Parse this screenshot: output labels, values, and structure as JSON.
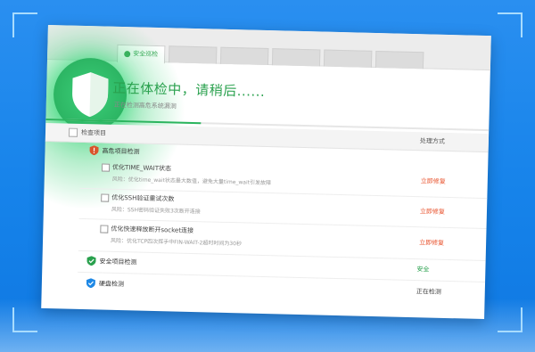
{
  "colors": {
    "accent_green": "#2aa14e",
    "fix_red": "#e8512b",
    "background_blue": "#1683ea"
  },
  "tabs": [
    {
      "label": "安全巡检",
      "active": true
    },
    {
      "label": ""
    },
    {
      "label": ""
    },
    {
      "label": ""
    },
    {
      "label": ""
    },
    {
      "label": ""
    }
  ],
  "status": {
    "title": "正在体检中，请稍后......",
    "subtitle": "正在检测高危系统漏洞",
    "progress": 0.35
  },
  "table": {
    "header_label": "检查项目",
    "header_status": "处理方式"
  },
  "groups": [
    {
      "label": "高危项目检测",
      "icon": "warning-shield-icon",
      "items": [
        {
          "name": "优化TIME_WAIT状态",
          "desc": "风险：优化time_wait状态最大数值，避免大量time_wait引发故障",
          "action": "立即修复"
        },
        {
          "name": "优化SSH验证重试次数",
          "desc": "风险：SSH密码验证失败3次断开连接",
          "action": "立即修复"
        },
        {
          "name": "优化快速释放断开socket连接",
          "desc": "风险：优化TCP四次挥手中FIN-WAIT-2超时时间为30秒",
          "action": "立即修复"
        }
      ]
    },
    {
      "label": "安全项目检测",
      "icon": "green-shield-icon",
      "status": "安全"
    },
    {
      "label": "硬盘检测",
      "icon": "blue-shield-icon",
      "status": "正在检测"
    }
  ]
}
